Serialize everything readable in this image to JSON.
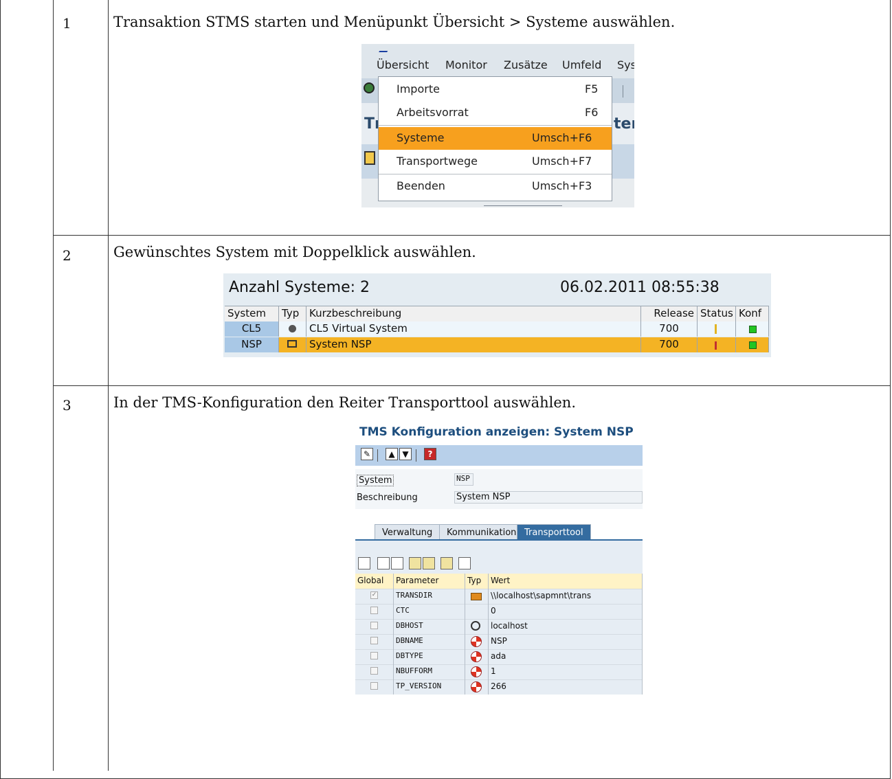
{
  "rows": [
    {
      "num": "1",
      "text": "Transaktion STMS starten und Menüpunkt Übersicht > Systeme auswählen."
    },
    {
      "num": "2",
      "text": "Gewünschtes System mit Doppelklick auswählen."
    },
    {
      "num": "3",
      "text": "In der TMS-Konfiguration den Reiter Transporttool auswählen."
    }
  ],
  "menu": {
    "menubar": [
      "Übersicht",
      "Monitor",
      "Zusätze",
      "Umfeld",
      "Sys"
    ],
    "items": [
      {
        "label": "Importe",
        "key": "F5"
      },
      {
        "label": "Arbeitsvorrat",
        "key": "F6"
      },
      {
        "label": "Systeme",
        "key": "Umsch+F6"
      },
      {
        "label": "Transportwege",
        "key": "Umsch+F7"
      },
      {
        "label": "Beenden",
        "key": "Umsch+F3"
      }
    ],
    "selected_color": "#f7a01e",
    "partial_title_left": "Tı",
    "partial_title_right": "ter"
  },
  "systems": {
    "heading_left": "Anzahl Systeme:  2",
    "heading_right": "06.02.2011 08:55:38",
    "columns": [
      "System",
      "Typ",
      "Kurzbeschreibung",
      "Release",
      "Status",
      "Konf"
    ],
    "rows": [
      {
        "system": "CL5",
        "desc": "CL5 Virtual System",
        "release": "700"
      },
      {
        "system": "NSP",
        "desc": "System NSP",
        "release": "700"
      }
    ],
    "selected_color": "#f4b324"
  },
  "tms": {
    "title": "TMS Konfiguration anzeigen: System NSP",
    "system_label": "System",
    "system_value": "NSP",
    "desc_label": "Beschreibung",
    "desc_value": "System NSP",
    "tabs": [
      "Verwaltung",
      "Kommunikation",
      "Transporttool"
    ],
    "active_tab": "Transporttool",
    "columns": [
      "Global",
      "Parameter",
      "Typ",
      "Wert"
    ],
    "params": [
      {
        "param": "TRANSDIR",
        "value": "\\\\localhost\\sapmnt\\trans",
        "checked": true,
        "icon": "folder-icon"
      },
      {
        "param": "CTC",
        "value": "0",
        "checked": false,
        "icon": ""
      },
      {
        "param": "DBHOST",
        "value": "localhost",
        "checked": false,
        "icon": "spiral-icon"
      },
      {
        "param": "DBNAME",
        "value": "NSP",
        "checked": false,
        "icon": "lifebuoy-icon"
      },
      {
        "param": "DBTYPE",
        "value": "ada",
        "checked": false,
        "icon": "lifebuoy-icon"
      },
      {
        "param": "NBUFFORM",
        "value": "1",
        "checked": false,
        "icon": "lifebuoy-icon"
      },
      {
        "param": "TP_VERSION",
        "value": "266",
        "checked": false,
        "icon": "lifebuoy-icon"
      }
    ]
  }
}
